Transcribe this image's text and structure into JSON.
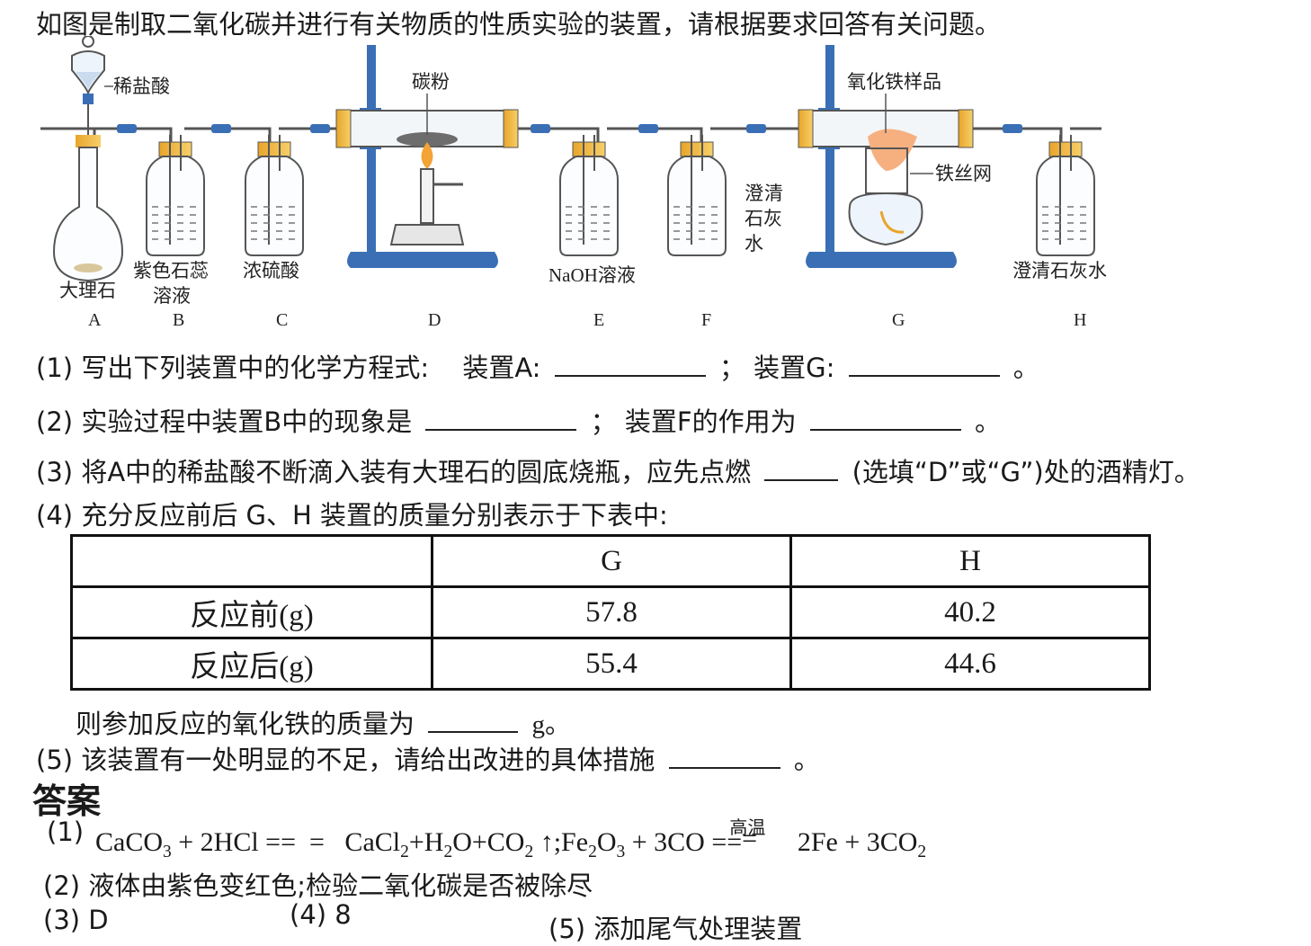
{
  "intro": "如图是制取二氧化碳并进行有关物质的性质实验的装置，请根据要求回答有关问题。",
  "diagram": {
    "labels": {
      "funnel": "稀盐酸",
      "carbon": "碳粉",
      "iron_oxide": "氧化铁样品",
      "iron_mesh": "铁丝网",
      "marble": "大理石",
      "litmus_1": "紫色石蕊",
      "litmus_2": "溶液",
      "acid": "浓硫酸",
      "naoh": "NaOH溶液",
      "lime_f_1": "澄",
      "lime_f_2": "清",
      "lime_f_3": "石灰",
      "lime_f_4": "水",
      "lime_h": "澄清石灰水"
    },
    "letters": [
      "A",
      "B",
      "C",
      "D",
      "E",
      "F",
      "G",
      "H"
    ]
  },
  "questions": {
    "q1_num": "(1)",
    "q1_text": "写出下列装置中的化学方程式:",
    "q1_a": "装置A:",
    "q1_sep": "；",
    "q1_g": "装置G:",
    "q1_end": "。",
    "q2_num": "(2)",
    "q2_text": "实验过程中装置B中的现象是",
    "q2_sep": "；",
    "q2_text2": "装置F的作用为",
    "q2_end": "。",
    "q3_num": "(3)",
    "q3_text": "将A中的稀盐酸不断滴入装有大理石的圆底烧瓶，应先点燃",
    "q3_text2": "(选填“D”或“G”)处的酒精灯。",
    "q4_num": "(4)",
    "q4_text": "充分反应前后 G、H 装置的质量分别表示于下表中:",
    "table": {
      "headers": [
        "",
        "G",
        "H"
      ],
      "rows": [
        {
          "label": "反应前(g)",
          "g": "57.8",
          "h": "40.2"
        },
        {
          "label": "反应后(g)",
          "g": "55.4",
          "h": "44.6"
        }
      ]
    },
    "q4_follow": "则参加反应的氧化铁的质量为",
    "q4_unit": "g。",
    "q5_num": "(5)",
    "q5_text": "该装置有一处明显的不足，请给出改进的具体措施",
    "q5_end": "。"
  },
  "answers": {
    "title": "答案",
    "a1_num": "(1)",
    "a1_part1": "CaCO",
    "a1_cond": "高温",
    "a2": "(2) 液体由紫色变红色;检验二氧化碳是否被除尽",
    "a3": "(3) D",
    "a4": "(4) 8",
    "a5": "(5) 添加尾气处理装置"
  }
}
